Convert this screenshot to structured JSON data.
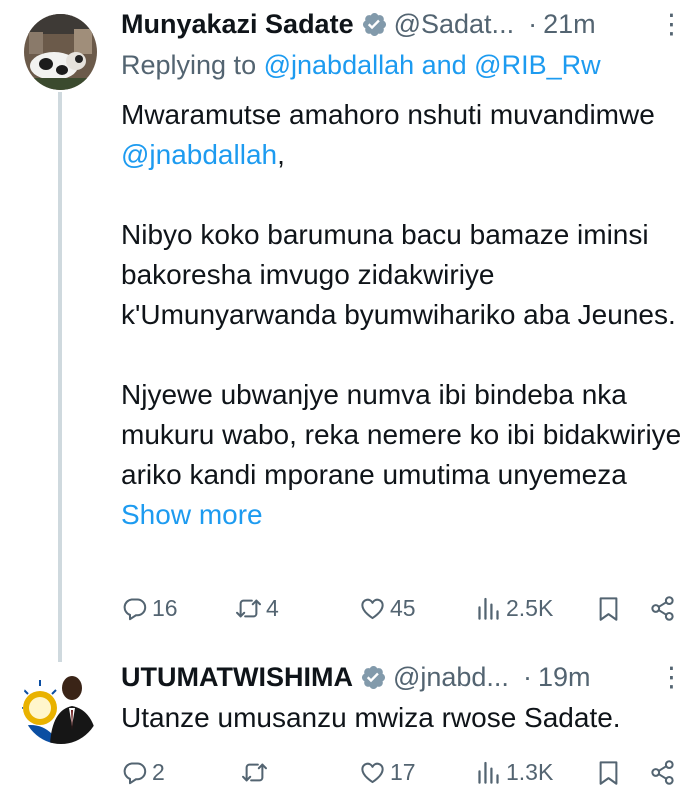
{
  "tweets": [
    {
      "author": "Munyakazi Sadate",
      "handle": "@Sadat...",
      "separator": "·",
      "time": "21m",
      "more": "⋮",
      "replying_prefix": "Replying to",
      "replying_mentions": "@jnabdallah and @RIB_Rw",
      "greeting": "Mwaramutse amahoro nshuti muvandimwe",
      "greeting_mention": "@jnabdallah",
      "greeting_suffix": ",",
      "paragraph2": "Nibyo koko barumuna bacu bamaze iminsi bakoresha imvugo zidakwiriye k'Umunyarwanda byumwihariko aba Jeunes.",
      "paragraph3": "Njyewe ubwanjye numva ibi bindeba nka mukuru wabo, reka nemere ko ibi bidakwiriye ariko kandi mporane umutima unyemeza",
      "show_more": "Show more",
      "stats": {
        "replies": "16",
        "reposts": "4",
        "likes": "45",
        "views": "2.5K"
      }
    },
    {
      "author": "UTUMATWISHIMA",
      "handle": "@jnabd...",
      "separator": "·",
      "time": "19m",
      "more": "⋮",
      "text": "Utanze umusanzu mwiza rwose Sadate.",
      "stats": {
        "replies": "2",
        "reposts": "",
        "likes": "17",
        "views": "1.3K"
      }
    }
  ],
  "colors": {
    "link": "#1d9bf0",
    "secondary_text": "#536471",
    "primary_text": "#0f1419",
    "verified_badge": "#829aab",
    "thread_line": "#cfd9de"
  },
  "icons": {
    "verified": "verified-badge-icon",
    "reply": "reply-icon",
    "repost": "repost-icon",
    "like": "heart-icon",
    "views": "views-bar-chart-icon",
    "bookmark": "bookmark-icon",
    "share": "share-icon",
    "more": "more-vertical-icon"
  }
}
